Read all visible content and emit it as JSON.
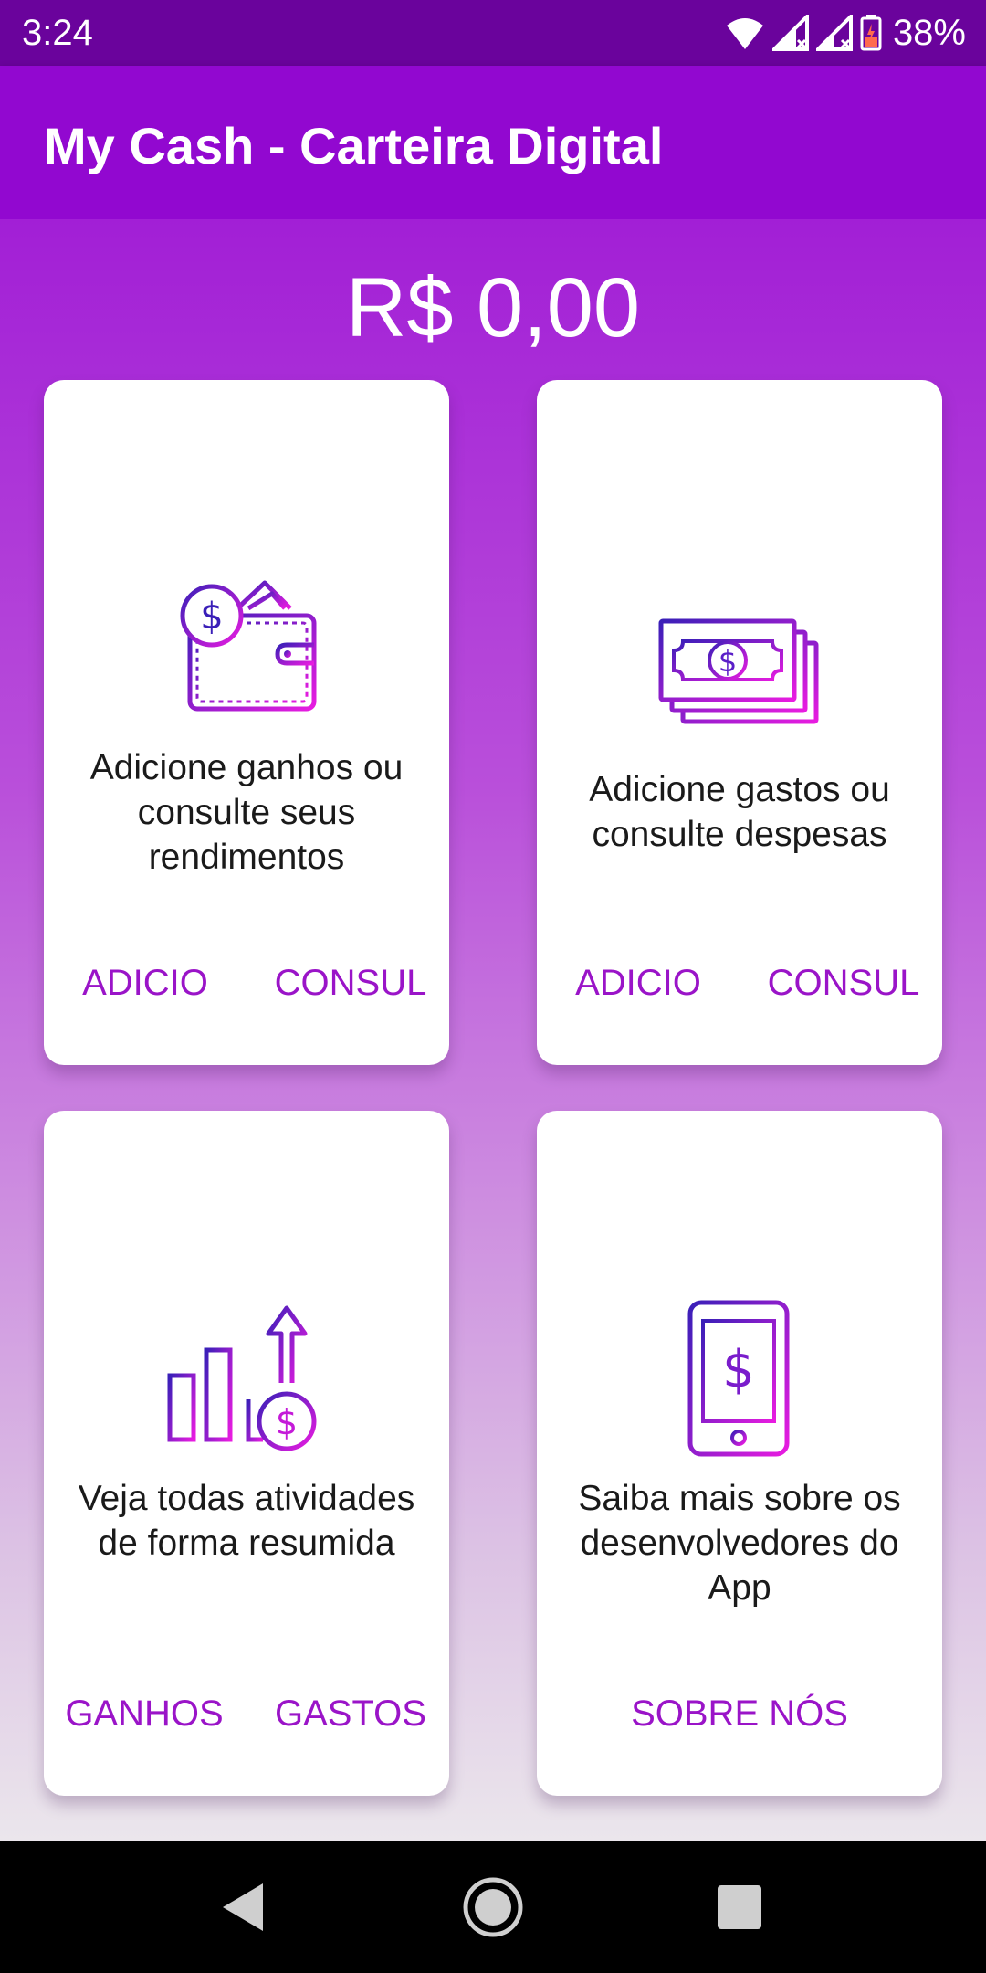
{
  "status_bar": {
    "time": "3:24",
    "battery": "38%",
    "icons": [
      "wifi-icon",
      "signal-icon",
      "signal-icon",
      "battery-icon"
    ]
  },
  "app_bar": {
    "title": "My Cash - Carteira Digital"
  },
  "balance": "R$ 0,00",
  "cards": [
    {
      "icon": "wallet-icon",
      "text": "Adicione ganhos ou consulte seus rendimentos",
      "buttons": [
        "ADICIO",
        "CONSUL"
      ]
    },
    {
      "icon": "banknotes-icon",
      "text": "Adicione gastos ou consulte despesas",
      "buttons": [
        "ADICIO",
        "CONSUL"
      ]
    },
    {
      "icon": "growth-chart-icon",
      "text": "Veja todas atividades de forma resumida",
      "buttons": [
        "GANHOS",
        "GASTOS"
      ]
    },
    {
      "icon": "smartphone-dollar-icon",
      "text": "Saiba mais sobre os desenvolvedores do App",
      "buttons": [
        "SOBRE NÓS"
      ]
    }
  ],
  "nav_bar": {
    "icons": [
      "back-icon",
      "home-icon",
      "recents-icon"
    ]
  },
  "colors": {
    "status_bar": "#6a039c",
    "app_bar": "#9208d0",
    "accent": "#9a14c8",
    "icon_gradient_start": "#3a1fb8",
    "icon_gradient_end": "#e81ce0"
  }
}
